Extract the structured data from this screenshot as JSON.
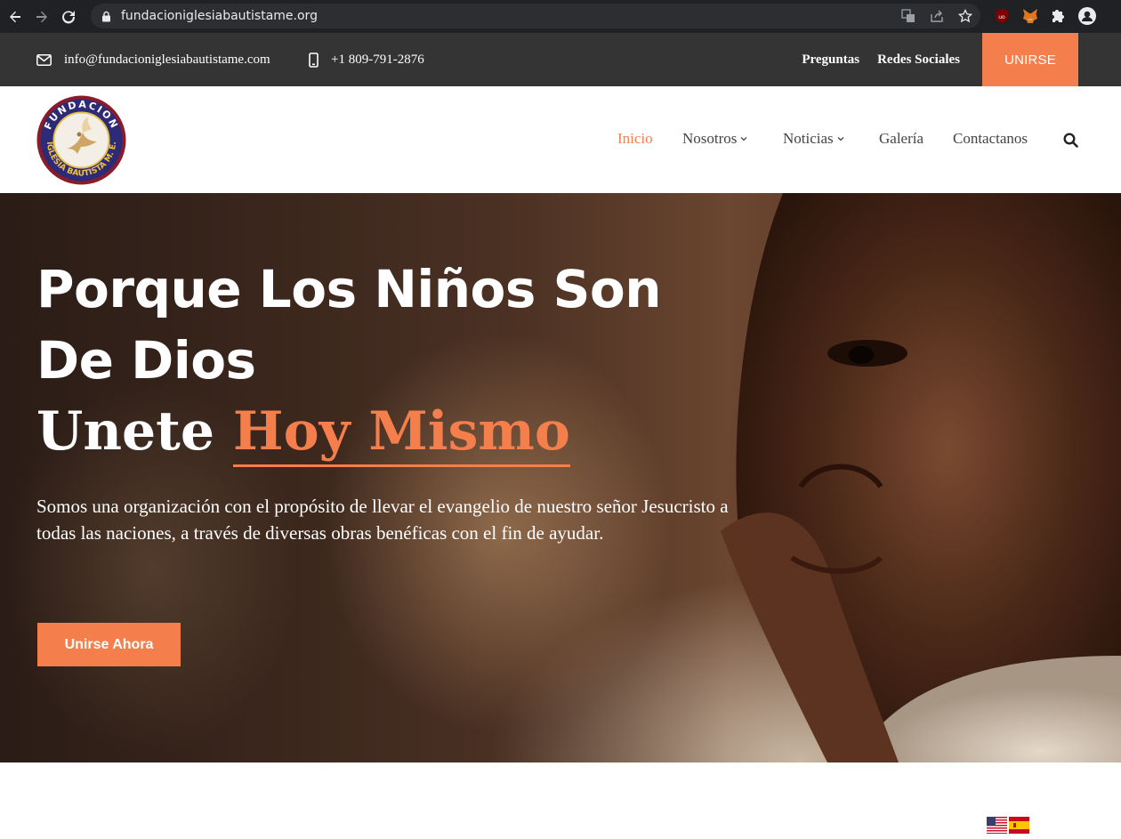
{
  "browser": {
    "url": "fundacioniglesiabautistame.org",
    "icons": [
      "back-icon",
      "forward-icon",
      "reload-icon",
      "lock-icon",
      "translate-icon",
      "share-icon",
      "bookmark-star-icon",
      "ublock-icon",
      "metamask-icon",
      "extensions-icon",
      "profile-icon"
    ]
  },
  "topbar": {
    "email": "info@fundacioniglesiabautistame.com",
    "phone": "+1 809-791-2876",
    "links": [
      "Preguntas",
      "Redes Sociales"
    ],
    "join_label": "UNIRSE"
  },
  "nav": {
    "items": [
      {
        "label": "Inicio",
        "active": true,
        "dropdown": false
      },
      {
        "label": "Nosotros",
        "active": false,
        "dropdown": true
      },
      {
        "label": "Noticias",
        "active": false,
        "dropdown": true
      },
      {
        "label": "Galería",
        "active": false,
        "dropdown": false
      },
      {
        "label": "Contactanos",
        "active": false,
        "dropdown": false
      }
    ]
  },
  "logo": {
    "text_top": "FUNDACION",
    "text_bottom": "IGLESIA BAUTISTA M. E."
  },
  "hero": {
    "title": "Porque Los Niños Son De Dios",
    "line2_prefix": "Unete",
    "line2_accent": "Hoy Mismo",
    "description": "Somos una organización con el propósito de llevar el evangelio de nuestro señor Jesucristo a todas las naciones, a través de diversas obras benéficas con el fin de ayudar.",
    "cta_label": "Unirse Ahora"
  },
  "colors": {
    "accent": "#f47f4c",
    "topbar_bg": "#343434",
    "chrome_bg": "#202124"
  },
  "languages": [
    "en",
    "es"
  ]
}
